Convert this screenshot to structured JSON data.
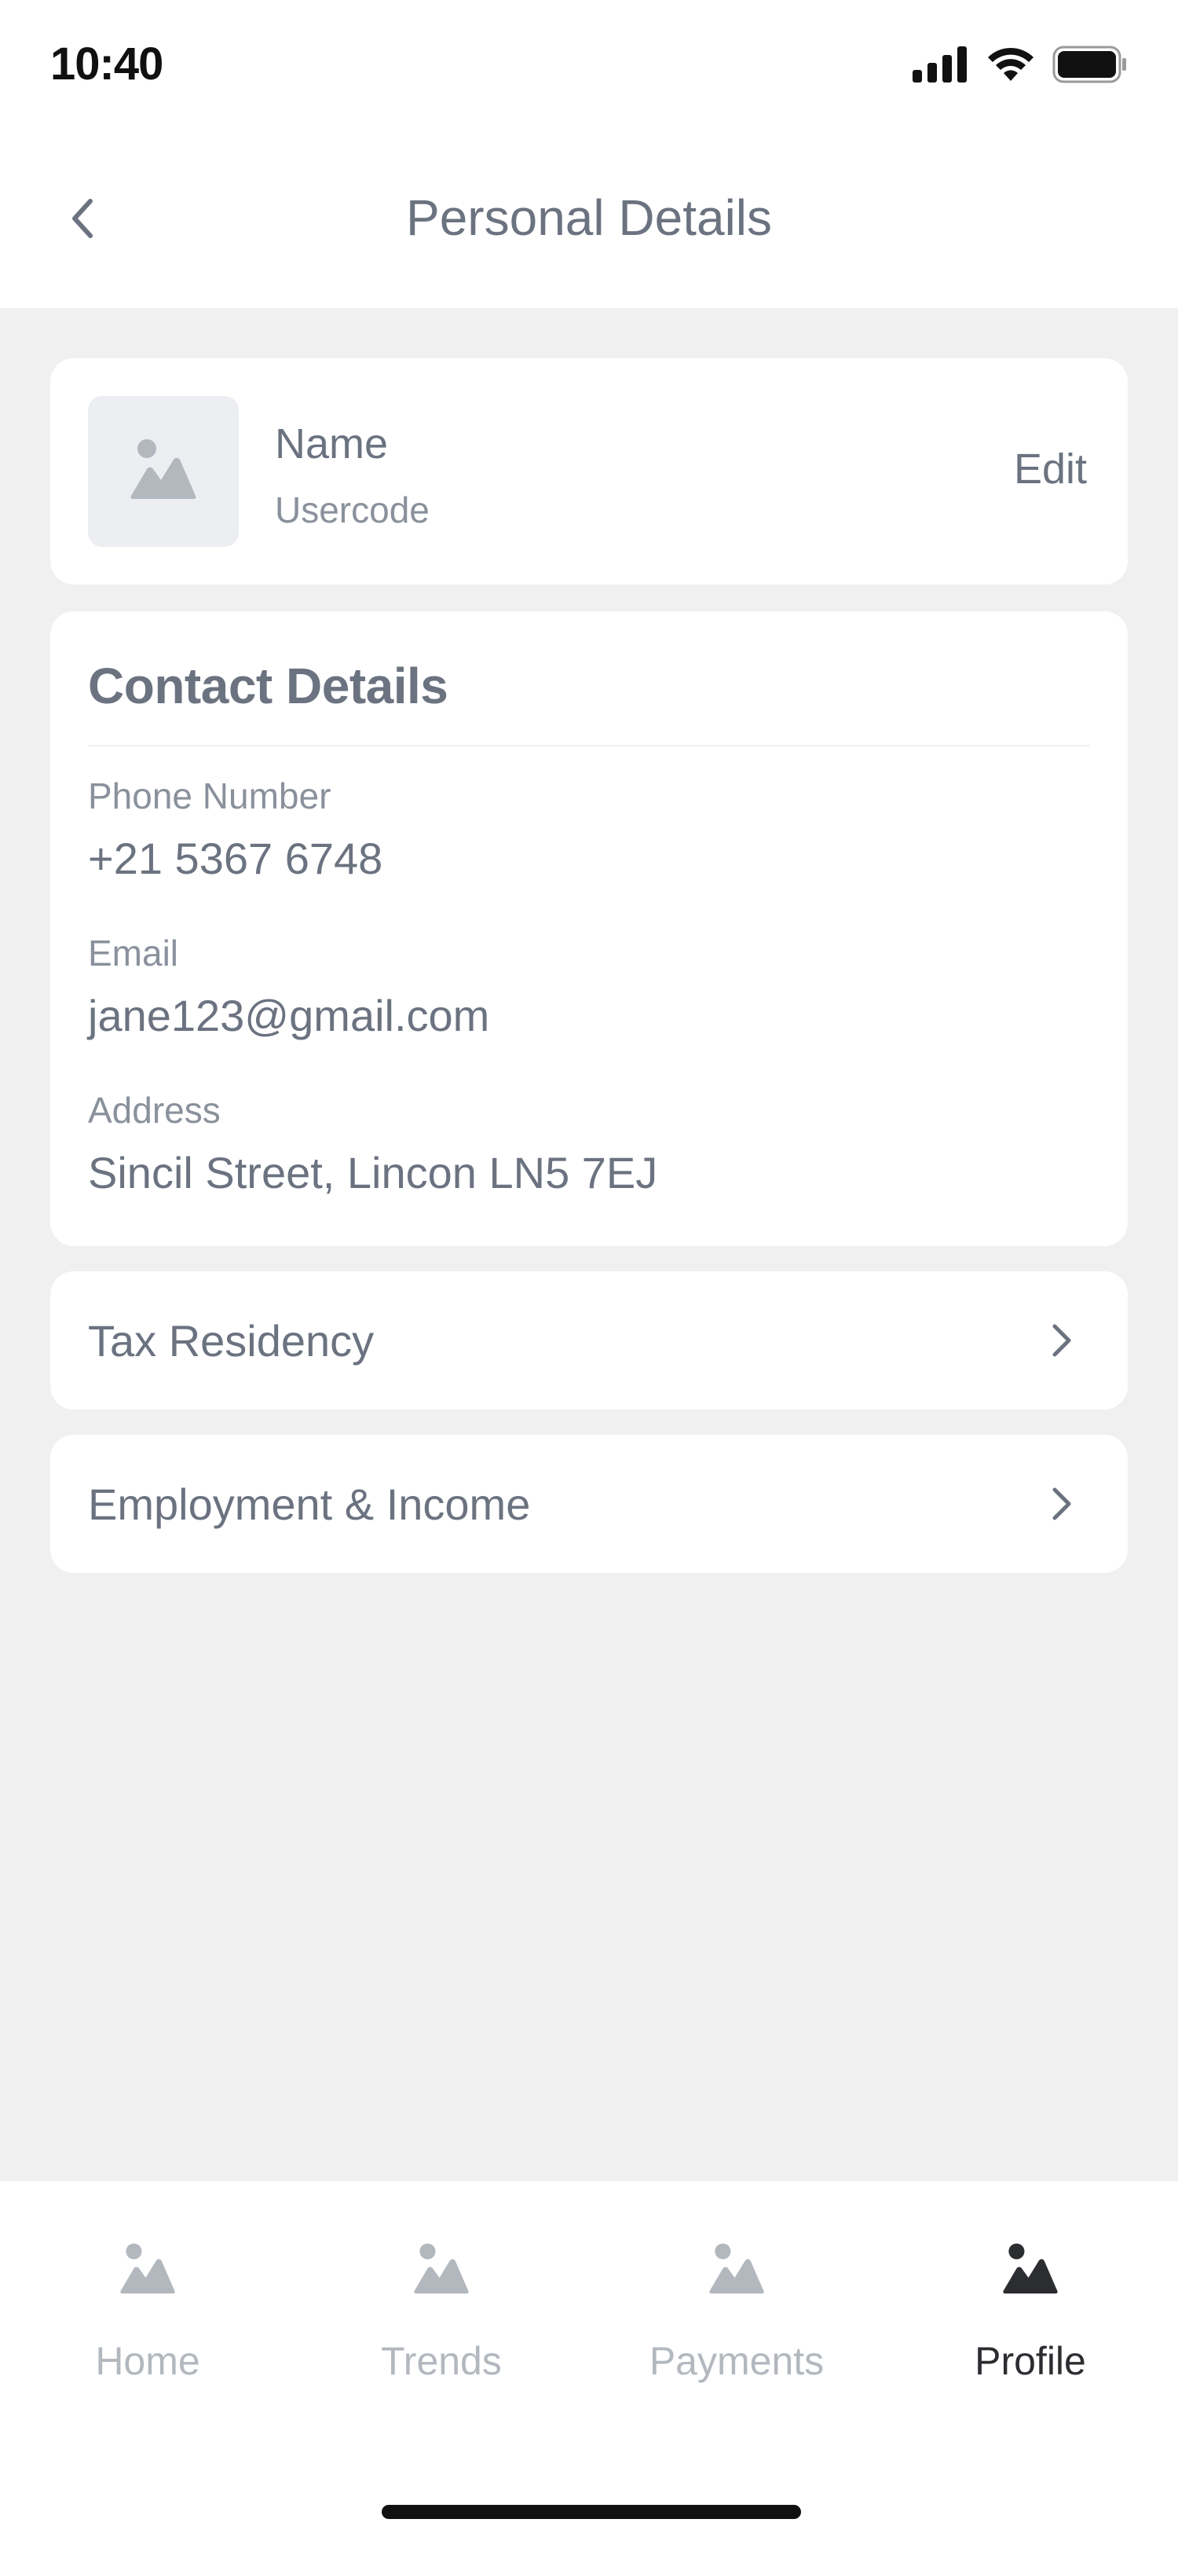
{
  "status_bar": {
    "time": "10:40"
  },
  "header": {
    "title": "Personal Details",
    "back_icon": "chevron-left-icon"
  },
  "profile": {
    "name": "Name",
    "usercode": "Usercode",
    "edit_label": "Edit",
    "avatar_icon": "image-placeholder-icon"
  },
  "contact": {
    "title": "Contact Details",
    "fields": [
      {
        "label": "Phone Number",
        "value": "+21 5367 6748"
      },
      {
        "label": "Email",
        "value": "jane123@gmail.com"
      },
      {
        "label": "Address",
        "value": "Sincil Street, Lincon LN5 7EJ"
      }
    ]
  },
  "rows": [
    {
      "label": "Tax Residency",
      "icon": "chevron-right-icon"
    },
    {
      "label": "Employment & Income",
      "icon": "chevron-right-icon"
    }
  ],
  "tabs": [
    {
      "label": "Home",
      "icon": "image-placeholder-icon",
      "active": false
    },
    {
      "label": "Trends",
      "icon": "image-placeholder-icon",
      "active": false
    },
    {
      "label": "Payments",
      "icon": "image-placeholder-icon",
      "active": false
    },
    {
      "label": "Profile",
      "icon": "image-placeholder-icon",
      "active": true
    }
  ],
  "colors": {
    "background": "#f0f0f0",
    "card": "#ffffff",
    "text": "#6b7280",
    "muted": "#8a919c",
    "tab_inactive": "#b3b8bf",
    "tab_active": "#2b2d31"
  }
}
